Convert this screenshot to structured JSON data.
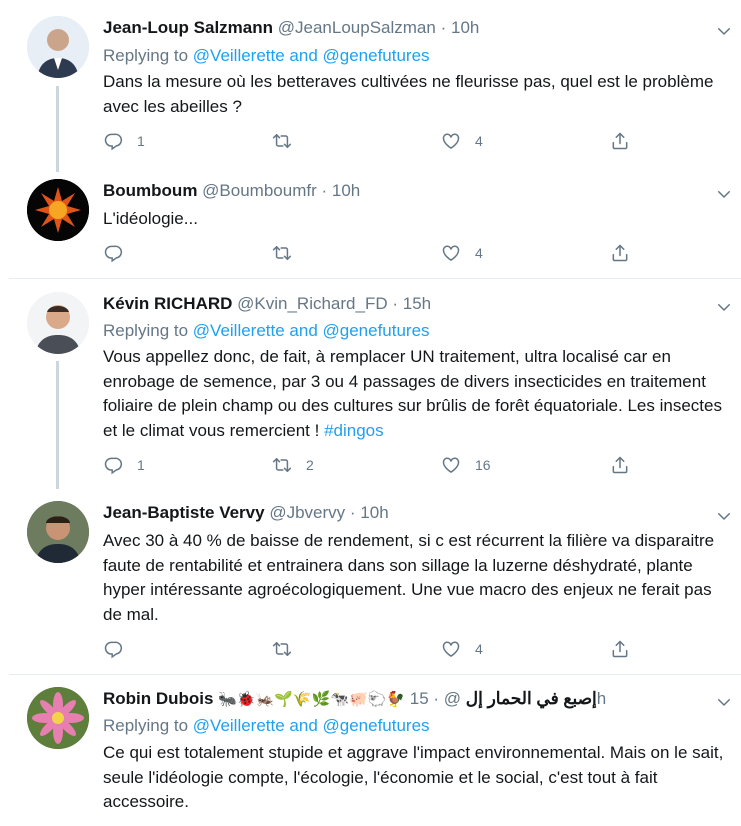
{
  "tweets": [
    {
      "name": "Jean-Loup Salzmann",
      "handle": "@JeanLoupSalzman",
      "time": "10h",
      "reply_prefix": "Replying to ",
      "reply_links": "@Veillerette and @genefutures",
      "text": "Dans la mesure où les betteraves cultivées ne fleurisse pas, quel est le problème avec les abeilles ?",
      "replies": "1",
      "retweets": "",
      "likes": "4"
    },
    {
      "name": "Boumboum",
      "handle": "@Boumboumfr",
      "time": "10h",
      "text": "L'idéologie...",
      "replies": "",
      "retweets": "",
      "likes": "4"
    },
    {
      "name": "Kévin RICHARD",
      "handle": "@Kvin_Richard_FD",
      "time": "15h",
      "reply_prefix": "Replying to ",
      "reply_links": "@Veillerette and @genefutures",
      "text": "Vous appellez donc, de fait, à remplacer UN traitement, ultra localisé car en enrobage de semence, par 3 ou 4 passages de divers insecticides en traitement foliaire de plein champ ou des cultures sur brûlis de forêt équatoriale. Les insectes et le climat vous remercient ! ",
      "hashtag": "#dingos",
      "replies": "1",
      "retweets": "2",
      "likes": "16"
    },
    {
      "name": "Jean-Baptiste Vervy",
      "handle": "@Jbvervy",
      "time": "10h",
      "text": "Avec 30 à 40 % de baisse de rendement, si c est récurrent la filière va disparaitre faute de rentabilité et entrainera dans son sillage la luzerne déshydraté, plante hyper intéressante agroécologiquement. Une vue macro des enjeux ne ferait pas de mal.",
      "replies": "",
      "retweets": "",
      "likes": "4"
    },
    {
      "name": "Robin Dubois",
      "emojis": "🐜🐞🦗🌱🌾🌿🐄🐖🐑🐓",
      "arabic": "إصبع في الحمار إل",
      "handle": "@",
      "time": "15h",
      "reply_prefix": "Replying to ",
      "reply_links": "@Veillerette and @genefutures",
      "text": "Ce qui est totalement stupide et aggrave l'impact environnemental. Mais on le sait, seule l'idéologie compte, l'écologie, l'économie et le social, c'est tout à fait accessoire."
    }
  ],
  "separator_dot": "·",
  "icons": [
    "reply-icon",
    "retweet-icon",
    "like-icon",
    "share-icon",
    "chevron-down-icon"
  ],
  "colors": {
    "link": "#1da1f2",
    "secondary": "#657786",
    "thread_line": "#ccd6dd",
    "divider": "#e6ecf0"
  }
}
